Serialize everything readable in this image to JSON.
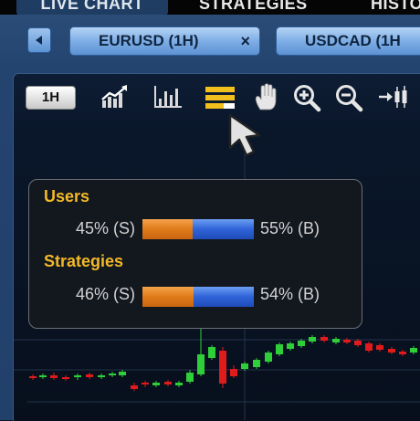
{
  "top_nav": {
    "tabs": [
      {
        "label": "LIVE CHART",
        "active": true
      },
      {
        "label": "STRATEGIES",
        "active": false
      },
      {
        "label": "HISTO",
        "active": false
      }
    ]
  },
  "chart_tabs": [
    {
      "label": "EURUSD (1H)",
      "close": "×"
    },
    {
      "label": "USDCAD (1H",
      "close": ""
    }
  ],
  "toolbar": {
    "timeframe": "1H",
    "tools": [
      "line-chart-icon",
      "bar-chart-icon",
      "sentiment-icon",
      "pan-hand-icon",
      "zoom-in-icon",
      "zoom-out-icon",
      "scroll-to-latest-icon"
    ],
    "active_tool": "sentiment-icon",
    "accent": "#f2c01c"
  },
  "sentiment": {
    "users": {
      "title": "Users",
      "sell_label": "45% (S)",
      "buy_label": "55% (B)",
      "sell_fraction": 0.45,
      "buy_fraction": 0.55
    },
    "strategies": {
      "title": "Strategies",
      "sell_label": "46% (S)",
      "buy_label": "54% (B)",
      "sell_fraction": 0.46,
      "buy_fraction": 0.54
    },
    "colors": {
      "title": "#f2b928",
      "sell": "#e07b1a",
      "buy": "#2f63d8"
    }
  },
  "colors": {
    "up": "#2fcf3a",
    "down": "#e01b1b",
    "frame": "#244470",
    "chart_bg": "#0a172b"
  }
}
